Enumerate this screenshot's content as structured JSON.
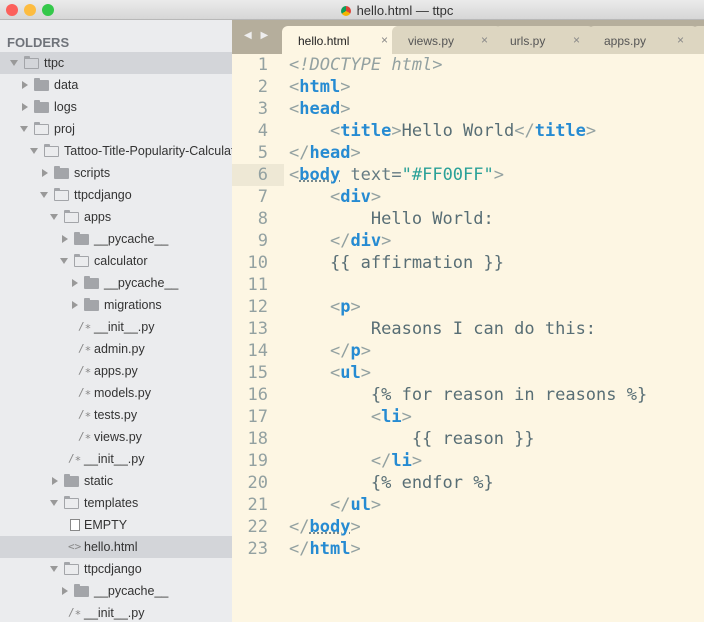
{
  "window": {
    "title": "hello.html — ttpc"
  },
  "sidebar": {
    "heading": "FOLDERS",
    "items": [
      {
        "level": 0,
        "kind": "folder",
        "open": true,
        "label": "ttpc",
        "selected": true
      },
      {
        "level": 1,
        "kind": "folder",
        "open": false,
        "label": "data"
      },
      {
        "level": 1,
        "kind": "folder",
        "open": false,
        "label": "logs"
      },
      {
        "level": 1,
        "kind": "folder",
        "open": true,
        "label": "proj"
      },
      {
        "level": 2,
        "kind": "folder",
        "open": true,
        "label": "Tattoo-Title-Popularity-Calculator"
      },
      {
        "level": 3,
        "kind": "folder",
        "open": false,
        "label": "scripts"
      },
      {
        "level": 3,
        "kind": "folder",
        "open": true,
        "label": "ttpcdjango"
      },
      {
        "level": 4,
        "kind": "folder",
        "open": true,
        "label": "apps"
      },
      {
        "level": 5,
        "kind": "folder",
        "open": false,
        "label": "__pycache__"
      },
      {
        "level": 5,
        "kind": "folder",
        "open": true,
        "label": "calculator"
      },
      {
        "level": 6,
        "kind": "folder",
        "open": false,
        "label": "__pycache__"
      },
      {
        "level": 6,
        "kind": "folder",
        "open": false,
        "label": "migrations"
      },
      {
        "level": 6,
        "kind": "py",
        "label": "__init__.py"
      },
      {
        "level": 6,
        "kind": "py",
        "label": "admin.py"
      },
      {
        "level": 6,
        "kind": "py",
        "label": "apps.py"
      },
      {
        "level": 6,
        "kind": "py",
        "label": "models.py"
      },
      {
        "level": 6,
        "kind": "py",
        "label": "tests.py"
      },
      {
        "level": 6,
        "kind": "py",
        "label": "views.py"
      },
      {
        "level": 5,
        "kind": "py",
        "label": "__init__.py"
      },
      {
        "level": 4,
        "kind": "folder",
        "open": false,
        "label": "static"
      },
      {
        "level": 4,
        "kind": "folder",
        "open": true,
        "label": "templates"
      },
      {
        "level": 5,
        "kind": "doc",
        "label": "EMPTY"
      },
      {
        "level": 5,
        "kind": "html",
        "label": "hello.html",
        "selected": true
      },
      {
        "level": 4,
        "kind": "folder",
        "open": true,
        "label": "ttpcdjango"
      },
      {
        "level": 5,
        "kind": "folder",
        "open": false,
        "label": "__pycache__"
      },
      {
        "level": 5,
        "kind": "py",
        "label": "__init__.py"
      }
    ]
  },
  "tabs": [
    {
      "label": "hello.html",
      "active": true
    },
    {
      "label": "views.py"
    },
    {
      "label": "urls.py"
    },
    {
      "label": "apps.py"
    }
  ],
  "tab_close": "×",
  "icons": {
    "py": "/∗",
    "html": "<>",
    "nav": "◀ ▶"
  },
  "editor": {
    "current_line": 6,
    "lines": [
      [
        [
          "c",
          "<!DOCTYPE html>"
        ]
      ],
      [
        [
          "p",
          "<"
        ],
        [
          "tg",
          "html"
        ],
        [
          "p",
          ">"
        ]
      ],
      [
        [
          "p",
          "<"
        ],
        [
          "tg",
          "head"
        ],
        [
          "p",
          ">"
        ]
      ],
      [
        [
          "a",
          "    "
        ],
        [
          "p",
          "<"
        ],
        [
          "tg",
          "title"
        ],
        [
          "p",
          ">"
        ],
        [
          "tx",
          "Hello World"
        ],
        [
          "p",
          "</"
        ],
        [
          "tg",
          "title"
        ],
        [
          "p",
          ">"
        ]
      ],
      [
        [
          "p",
          "</"
        ],
        [
          "tg",
          "head"
        ],
        [
          "p",
          ">"
        ]
      ],
      [
        [
          "p",
          "<"
        ],
        [
          "tg ul",
          "body"
        ],
        [
          "a",
          " text="
        ],
        [
          "s",
          "\"#FF00FF\""
        ],
        [
          "p",
          ">"
        ]
      ],
      [
        [
          "a",
          "    "
        ],
        [
          "p",
          "<"
        ],
        [
          "tg",
          "div"
        ],
        [
          "p",
          ">"
        ]
      ],
      [
        [
          "tx",
          "        Hello World:"
        ]
      ],
      [
        [
          "a",
          "    "
        ],
        [
          "p",
          "</"
        ],
        [
          "tg",
          "div"
        ],
        [
          "p",
          ">"
        ]
      ],
      [
        [
          "tx",
          "    {{ affirmation }}"
        ]
      ],
      [],
      [
        [
          "a",
          "    "
        ],
        [
          "p",
          "<"
        ],
        [
          "tg",
          "p"
        ],
        [
          "p",
          ">"
        ]
      ],
      [
        [
          "tx",
          "        Reasons I can do this:"
        ]
      ],
      [
        [
          "a",
          "    "
        ],
        [
          "p",
          "</"
        ],
        [
          "tg",
          "p"
        ],
        [
          "p",
          ">"
        ]
      ],
      [
        [
          "a",
          "    "
        ],
        [
          "p",
          "<"
        ],
        [
          "tg",
          "ul"
        ],
        [
          "p",
          ">"
        ]
      ],
      [
        [
          "tx",
          "        {% for reason in reasons %}"
        ]
      ],
      [
        [
          "a",
          "        "
        ],
        [
          "p",
          "<"
        ],
        [
          "tg",
          "li"
        ],
        [
          "p",
          ">"
        ]
      ],
      [
        [
          "tx",
          "            {{ reason }}"
        ]
      ],
      [
        [
          "a",
          "        "
        ],
        [
          "p",
          "</"
        ],
        [
          "tg",
          "li"
        ],
        [
          "p",
          ">"
        ]
      ],
      [
        [
          "tx",
          "        {% endfor %}"
        ]
      ],
      [
        [
          "a",
          "    "
        ],
        [
          "p",
          "</"
        ],
        [
          "tg",
          "ul"
        ],
        [
          "p",
          ">"
        ]
      ],
      [
        [
          "p",
          "</"
        ],
        [
          "tg ul",
          "body"
        ],
        [
          "p",
          ">"
        ]
      ],
      [
        [
          "p",
          "</"
        ],
        [
          "tg",
          "html"
        ],
        [
          "p",
          ">"
        ]
      ]
    ]
  }
}
